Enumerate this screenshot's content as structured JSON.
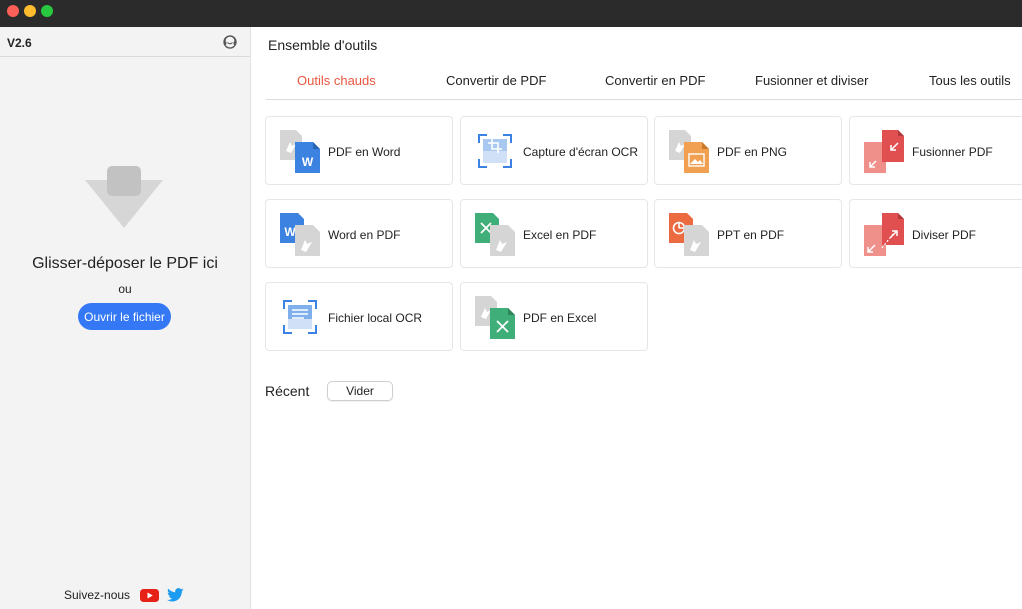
{
  "window": {
    "traffic_lights": [
      "close",
      "minimize",
      "zoom"
    ]
  },
  "sidebar": {
    "version": "V2.6",
    "support_icon": "headset-icon",
    "drop_icon": "download-arrow-icon",
    "drop_text": "Glisser-déposer le PDF ici",
    "or_text": "ou",
    "open_button_label": "Ouvrir le fichier",
    "follow_label": "Suivez-nous",
    "social_icons": [
      "youtube-icon",
      "twitter-icon"
    ]
  },
  "main": {
    "section_title": "Ensemble d'outils",
    "tabs": [
      {
        "label": "Outils chauds",
        "active": true
      },
      {
        "label": "Convertir de PDF",
        "active": false
      },
      {
        "label": "Convertir en PDF",
        "active": false
      },
      {
        "label": "Fusionner et diviser",
        "active": false
      },
      {
        "label": "Tous les outils",
        "active": false
      }
    ],
    "tools": [
      {
        "label": "PDF en Word",
        "icon": "pdf-to-word-icon"
      },
      {
        "label": "Capture d'écran OCR",
        "icon": "screenshot-ocr-icon"
      },
      {
        "label": "PDF en PNG",
        "icon": "pdf-to-png-icon"
      },
      {
        "label": "Fusionner PDF",
        "icon": "merge-pdf-icon"
      },
      {
        "label": "Word en PDF",
        "icon": "word-to-pdf-icon"
      },
      {
        "label": "Excel en PDF",
        "icon": "excel-to-pdf-icon"
      },
      {
        "label": "PPT en PDF",
        "icon": "ppt-to-pdf-icon"
      },
      {
        "label": "Diviser PDF",
        "icon": "split-pdf-icon"
      },
      {
        "label": "Fichier local OCR",
        "icon": "local-file-ocr-icon"
      },
      {
        "label": "PDF en Excel",
        "icon": "pdf-to-excel-icon"
      }
    ],
    "recent_label": "Récent",
    "clear_button_label": "Vider"
  },
  "colors": {
    "accent": "#e9573f",
    "primary_button": "#3478f6",
    "word": "#3c82e0",
    "excel": "#3fae78",
    "ppt": "#ec6a3f",
    "png": "#f0a050",
    "pdf_red": "#e05050"
  }
}
